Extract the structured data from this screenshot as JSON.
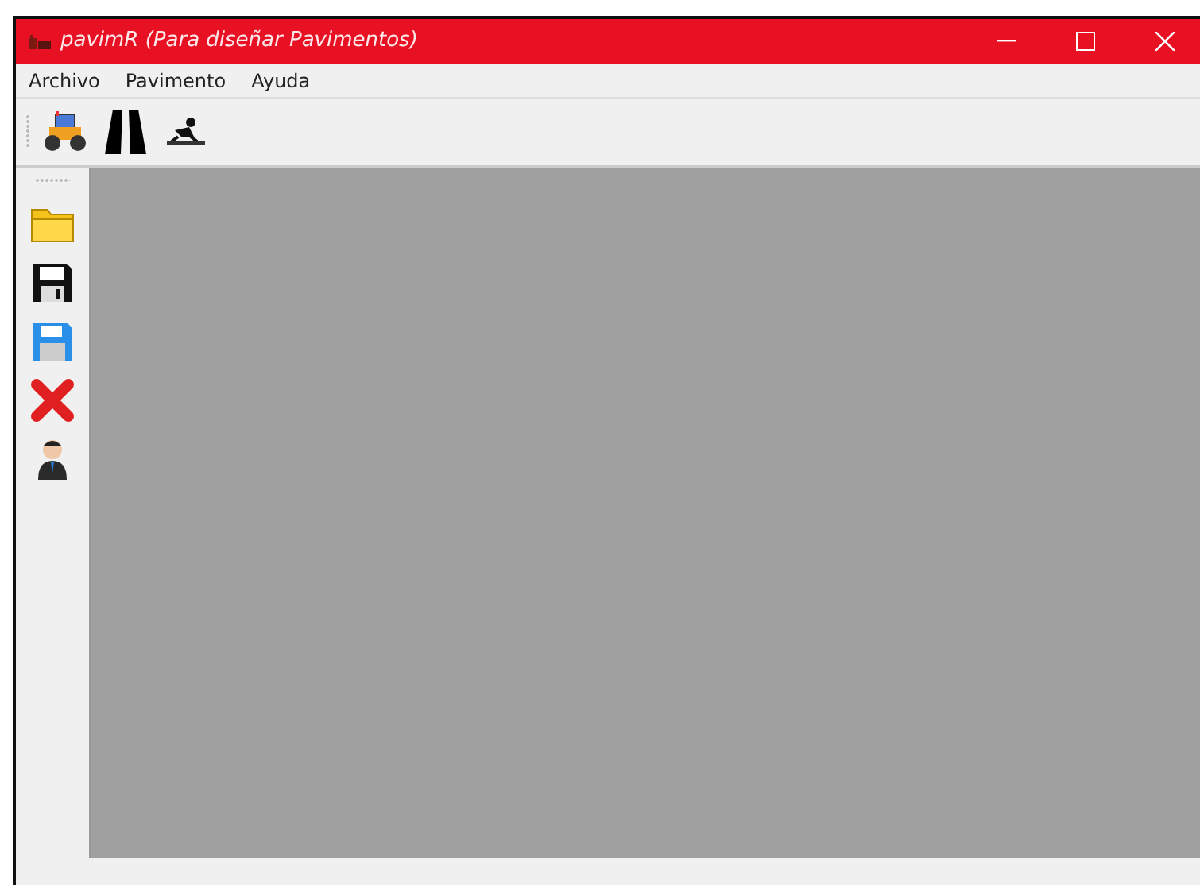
{
  "window": {
    "title": "pavimR (Para diseñar Pavimentos)"
  },
  "menu": [
    {
      "label": "Archivo"
    },
    {
      "label": "Pavimento"
    },
    {
      "label": "Ayuda"
    }
  ]
}
